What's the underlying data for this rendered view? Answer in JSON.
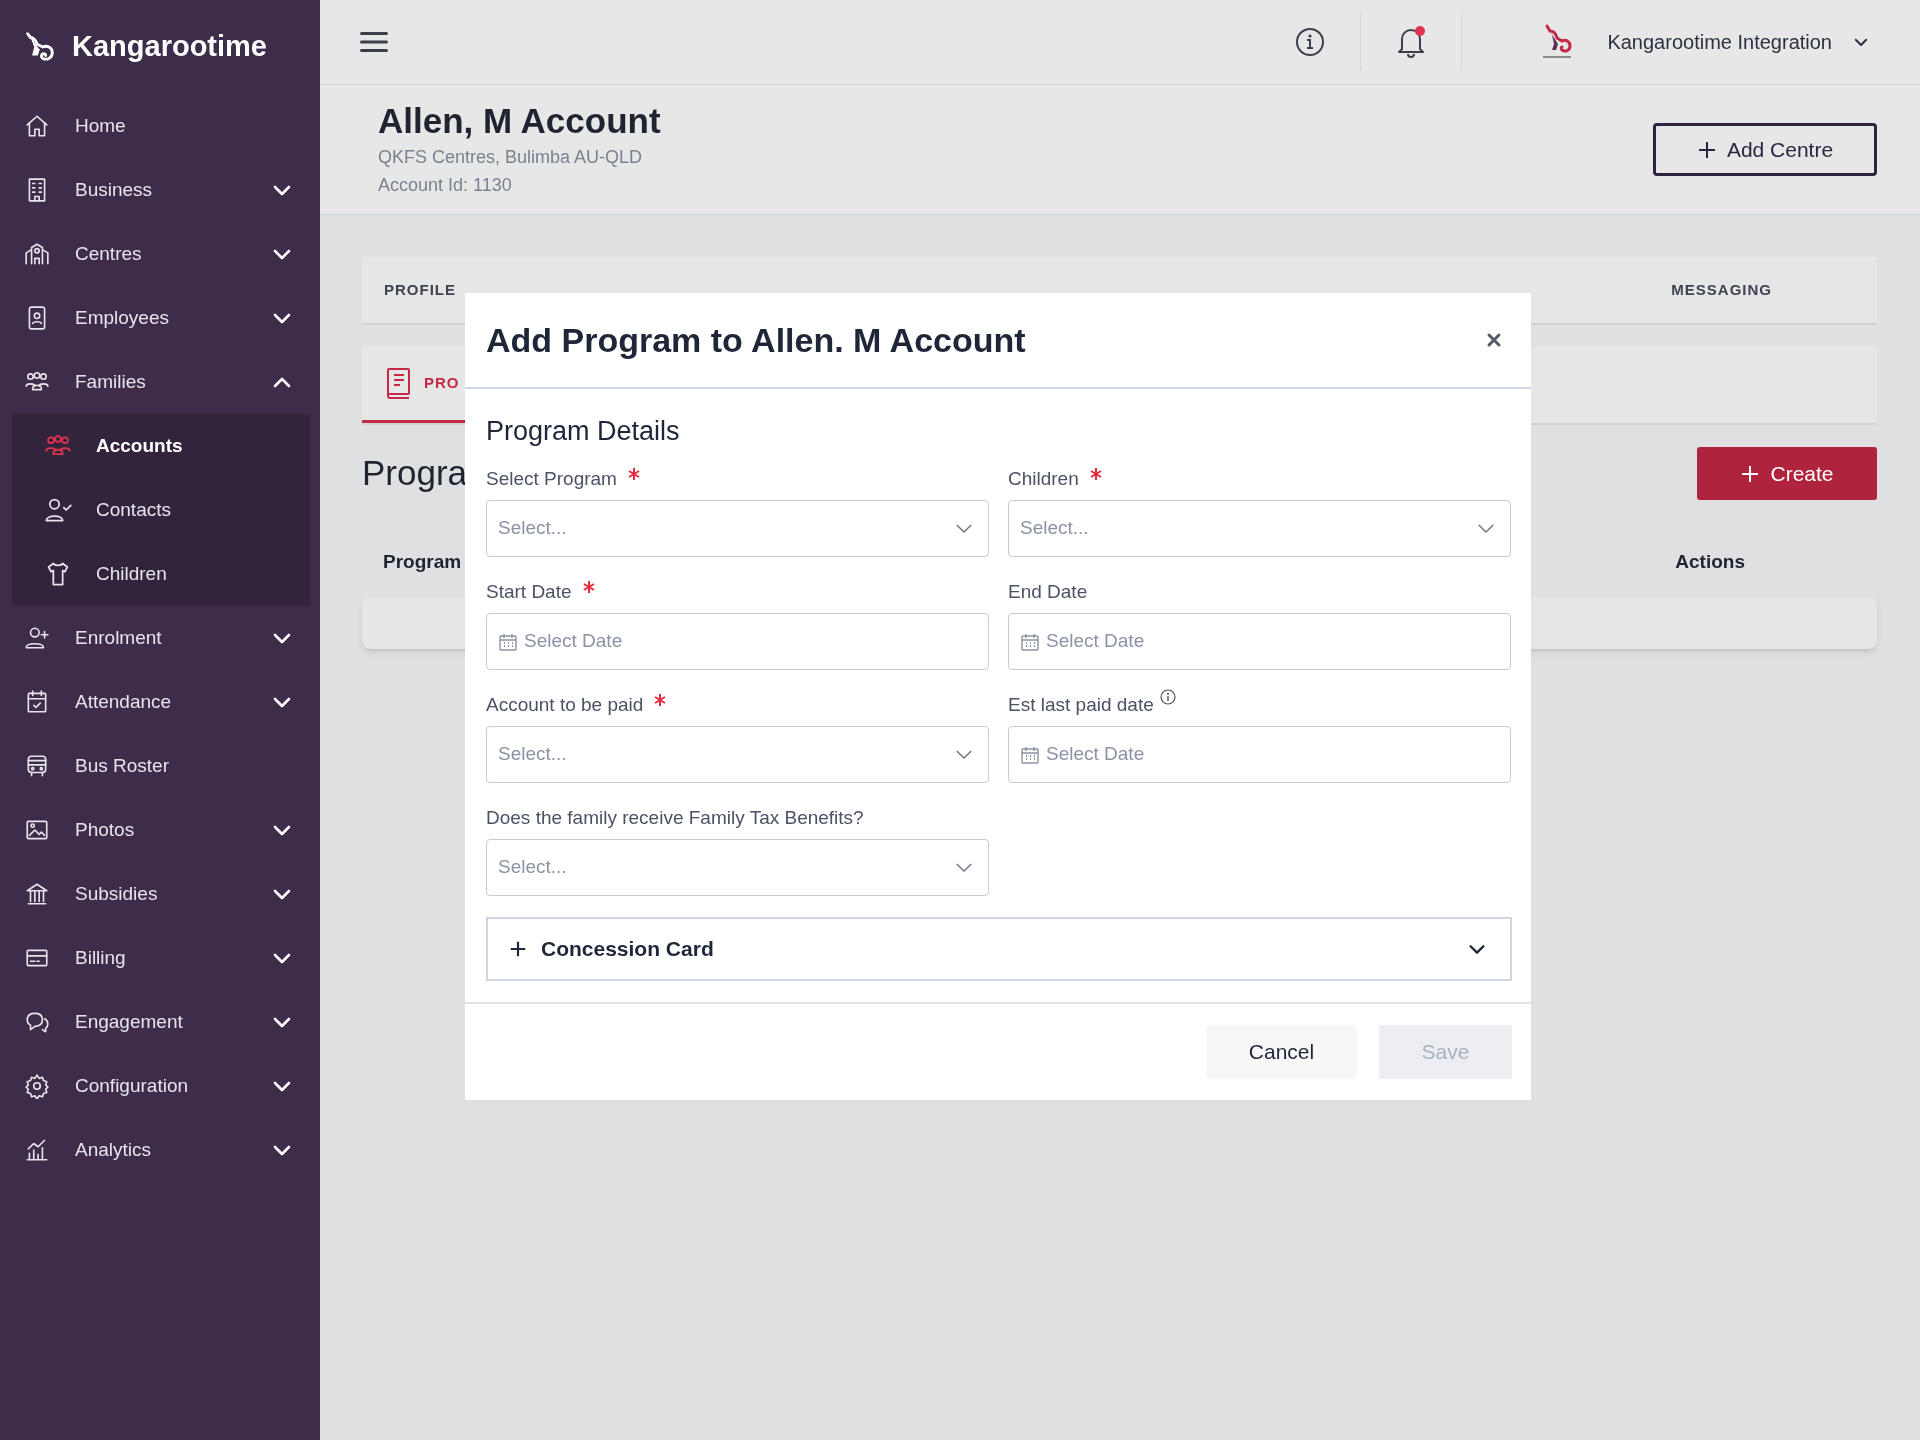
{
  "sidebar": {
    "brand": "Kangarootime",
    "items": [
      {
        "label": "Home"
      },
      {
        "label": "Business",
        "expanded": false
      },
      {
        "label": "Centres",
        "expanded": false
      },
      {
        "label": "Employees",
        "expanded": false
      },
      {
        "label": "Families",
        "expanded": true,
        "children": [
          {
            "label": "Accounts",
            "selected": true
          },
          {
            "label": "Contacts",
            "selected": false
          },
          {
            "label": "Children",
            "selected": false
          }
        ]
      },
      {
        "label": "Enrolment",
        "expanded": false
      },
      {
        "label": "Attendance",
        "expanded": false
      },
      {
        "label": "Bus Roster"
      },
      {
        "label": "Photos",
        "expanded": false
      },
      {
        "label": "Subsidies",
        "expanded": false
      },
      {
        "label": "Billing",
        "expanded": false
      },
      {
        "label": "Engagement",
        "expanded": false
      },
      {
        "label": "Configuration",
        "expanded": false
      },
      {
        "label": "Analytics",
        "expanded": false
      }
    ]
  },
  "header": {
    "notifications_unread": true,
    "organization": "Kangarootime Integration"
  },
  "page": {
    "title": "Allen, M Account",
    "subtitle_lines": [
      "QKFS Centres, Bulimba AU-QLD",
      "Account Id: 1130"
    ],
    "add_button": "Add Centre"
  },
  "tabs": [
    {
      "label": "PROFILE",
      "selected": false
    },
    {
      "label": "MESSAGING",
      "selected": false
    }
  ],
  "subtabs": [
    {
      "label": "PRO",
      "selected": true
    }
  ],
  "section": {
    "heading": "Progra",
    "create_button": "Create",
    "columns": [
      "Program",
      "Actions"
    ]
  },
  "modal": {
    "title": "Add Program to Allen. M Account",
    "section_title": "Program Details",
    "fields": [
      {
        "label": "Select Program",
        "required": true,
        "kind": "select",
        "placeholder": "Select..."
      },
      {
        "label": "Children",
        "required": true,
        "kind": "select",
        "placeholder": "Select..."
      },
      {
        "label": "Start Date",
        "required": true,
        "kind": "date",
        "placeholder": "Select Date"
      },
      {
        "label": "End Date",
        "required": false,
        "kind": "date",
        "placeholder": "Select Date"
      },
      {
        "label": "Account to be paid",
        "required": true,
        "kind": "select",
        "placeholder": "Select..."
      },
      {
        "label": "Est last paid date",
        "required": false,
        "info": true,
        "kind": "date",
        "placeholder": "Select Date"
      },
      {
        "label": "Does the family receive Family Tax Benefits?",
        "required": false,
        "kind": "select",
        "placeholder": "Select..."
      }
    ],
    "concession": {
      "label": "Concession Card",
      "expanded": false
    },
    "buttons": [
      {
        "label": "Cancel",
        "disabled": false
      },
      {
        "label": "Save",
        "disabled": true
      }
    ]
  }
}
